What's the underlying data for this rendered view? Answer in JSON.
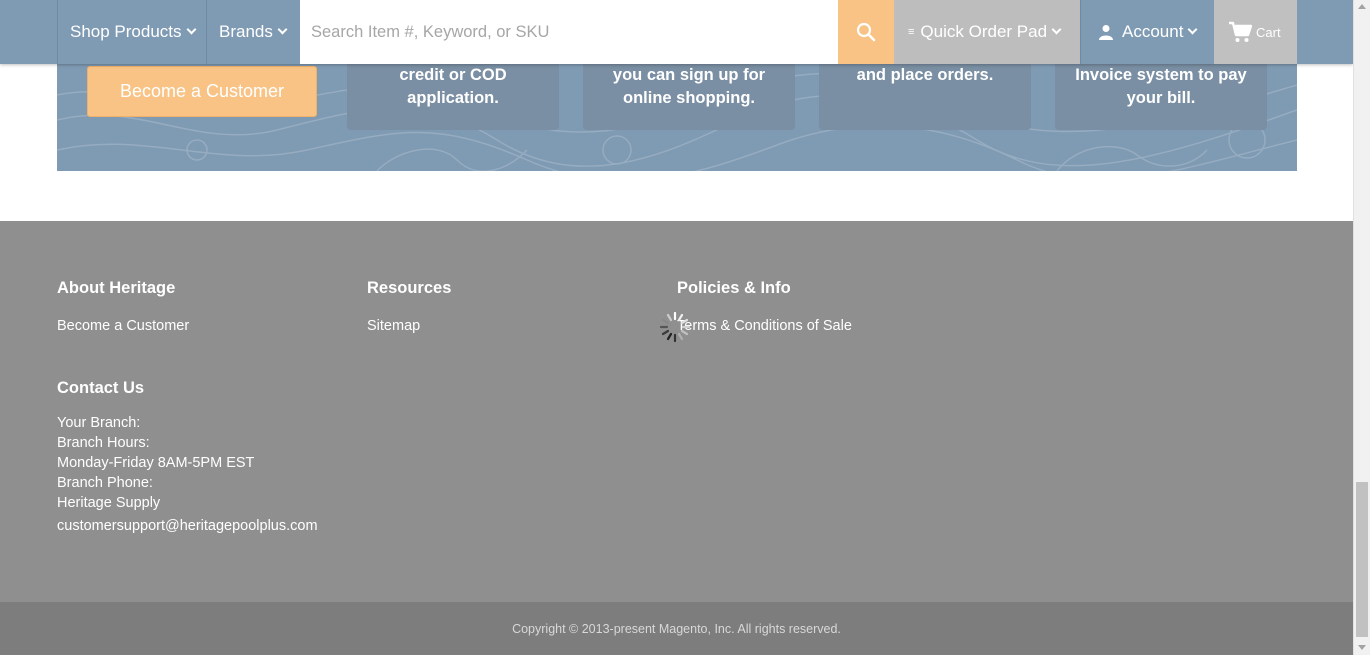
{
  "header": {
    "shop_products": "Shop Products",
    "brands": "Brands",
    "search_placeholder": "Search Item #, Keyword, or SKU",
    "quick_order_pad": "Quick Order Pad",
    "account": "Account",
    "cart": "Cart"
  },
  "banner": {
    "become_customer_button": "Become a Customer",
    "cards": [
      {
        "line1": "credit or COD",
        "line2": "application."
      },
      {
        "line1": "you can sign up for",
        "line2": "online shopping."
      },
      {
        "line1": "and place orders.",
        "line2": ""
      },
      {
        "line1": "Invoice system to pay",
        "line2": "your bill."
      }
    ]
  },
  "footer": {
    "about": {
      "title": "About Heritage",
      "links": [
        "Become a Customer"
      ]
    },
    "resources": {
      "title": "Resources",
      "links": [
        "Sitemap"
      ]
    },
    "policies": {
      "title": "Policies & Info",
      "links": [
        "Terms & Conditions of Sale"
      ]
    },
    "contact": {
      "title": "Contact Us",
      "lines": [
        "Your Branch:",
        "Branch Hours:",
        "Monday-Friday 8AM-5PM EST",
        "Branch Phone:",
        "Heritage Supply"
      ],
      "email": "customersupport@heritagepoolplus.com"
    },
    "copyright": "Copyright © 2013-present Magento, Inc. All rights reserved."
  },
  "colors": {
    "header_blue": "#7f9ab3",
    "accent_orange": "#f8c385",
    "footer_gray": "#8f8f8f",
    "copyright_gray": "#7d7d7d"
  },
  "icons": [
    "chevron-down-icon",
    "search-icon",
    "quick-order-icon",
    "user-icon",
    "cart-icon",
    "loading-spinner-icon"
  ]
}
